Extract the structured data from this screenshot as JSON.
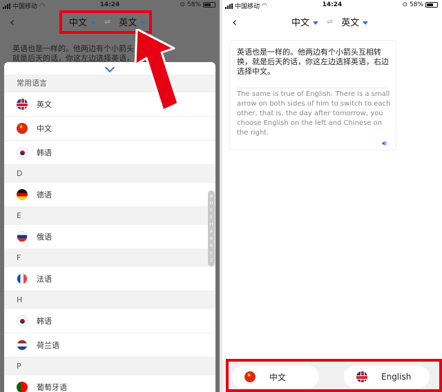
{
  "left_screen": {
    "status": {
      "carrier": "中国移动",
      "time": "14:24",
      "battery": "58%"
    },
    "nav": {
      "source_lang": "中文",
      "target_lang": "英文",
      "swap_symbol": "⇌"
    },
    "source_text_preview": "英语也是一样的。他两边有个小箭头互相转换，就是后天的话，你这左边选择英语，右边",
    "picker": {
      "sections": [
        {
          "header": "常用语言",
          "items": [
            {
              "label": "英文",
              "flag": "uk-flag"
            },
            {
              "label": "中文",
              "flag": "cn-flag"
            },
            {
              "label": "韩语",
              "flag": "kr-flag"
            }
          ]
        },
        {
          "header": "D",
          "items": [
            {
              "label": "德语",
              "flag": "de-flag"
            }
          ]
        },
        {
          "header": "E",
          "items": [
            {
              "label": "俄语",
              "flag": "ru-flag"
            }
          ]
        },
        {
          "header": "F",
          "items": [
            {
              "label": "法语",
              "flag": "fr-flag"
            }
          ]
        },
        {
          "header": "H",
          "items": [
            {
              "label": "韩语",
              "flag": "kr-flag"
            },
            {
              "label": "荷兰语",
              "flag": "nl-flag"
            }
          ]
        },
        {
          "header": "P",
          "items": [
            {
              "label": "葡萄牙语",
              "flag": "pt-flag"
            }
          ]
        }
      ],
      "index_letters": [
        "#",
        "D",
        "E",
        "F",
        "H",
        "P",
        "R",
        "X",
        "Y",
        "Z"
      ]
    }
  },
  "right_screen": {
    "status": {
      "carrier": "中国移动",
      "time": "14:24",
      "battery": "58%"
    },
    "nav": {
      "source_lang": "中文",
      "target_lang": "英文",
      "swap_symbol": "⇌"
    },
    "result": {
      "source": "英语也是一样的。他两边有个小箭头互相转换，就是后天的话，你这左边选择英语，右边选择中文。",
      "translation": "The same is true of English. There is a small arrow on both sides of him to switch to each other, that is, the day after tomorrow, you choose English on the left and Chinese on the right."
    },
    "bottom_bar": {
      "left_label": "中文",
      "right_label": "English"
    }
  },
  "colors": {
    "accent": "#2e6fd8",
    "highlight_red": "#e60012"
  }
}
